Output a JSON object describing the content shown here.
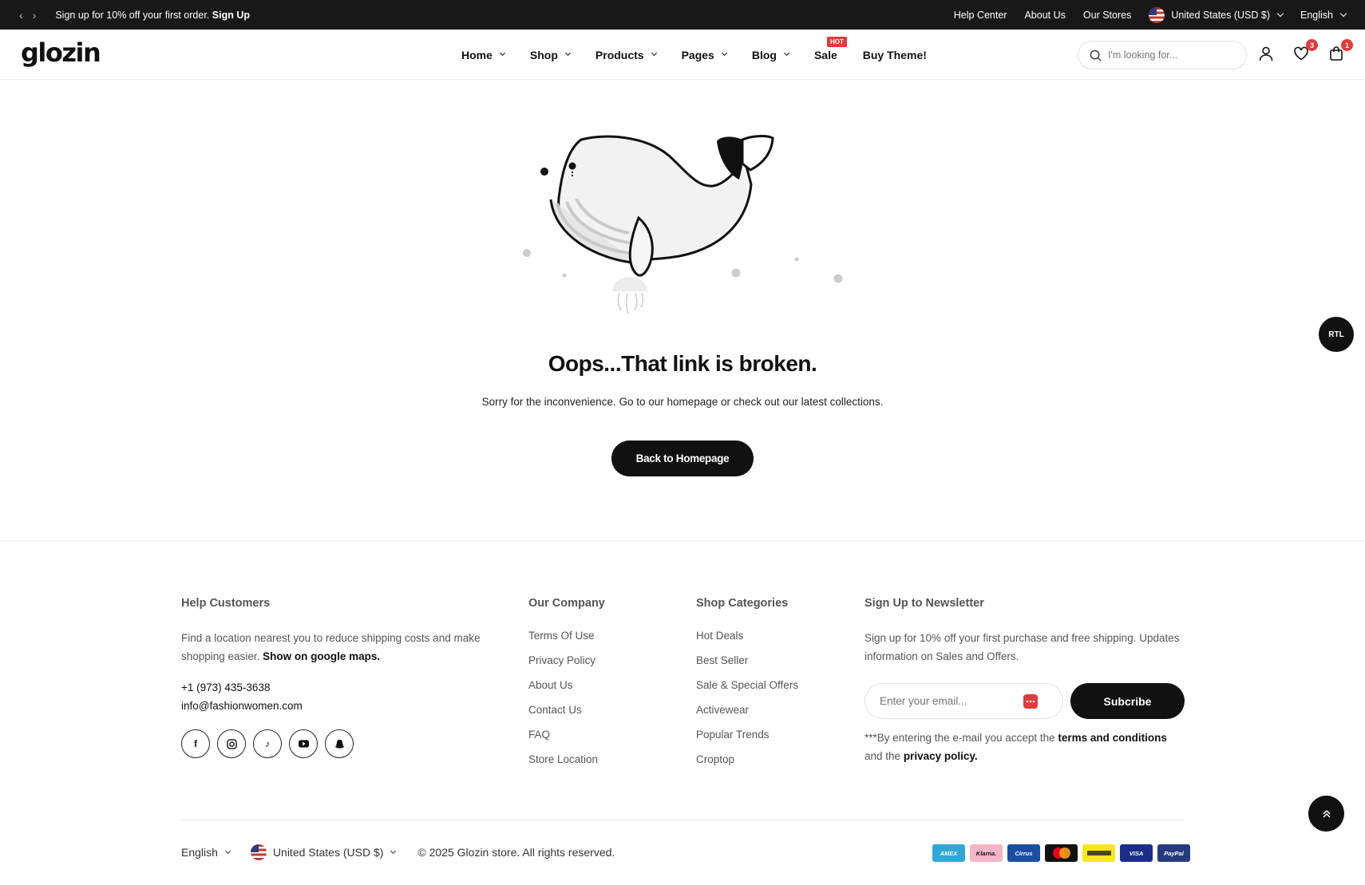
{
  "topbar": {
    "promo_text": "Sign up for 10% off your first order.",
    "promo_link": "Sign Up",
    "links": [
      "Help Center",
      "About Us",
      "Our Stores"
    ],
    "currency": "United States (USD $)",
    "language": "English"
  },
  "header": {
    "logo": "glozin",
    "nav": [
      "Home",
      "Shop",
      "Products",
      "Pages",
      "Blog",
      "Sale",
      "Buy Theme!"
    ],
    "hot_badge": "HOT",
    "search_placeholder": "I'm looking for...",
    "wishlist_count": "3",
    "cart_count": "1"
  },
  "error": {
    "title": "Oops...That link is broken.",
    "message": "Sorry for the inconvenience. Go to our homepage or check out our latest collections.",
    "button": "Back to Homepage"
  },
  "rtl_label": "RTL",
  "footer": {
    "help": {
      "heading": "Help Customers",
      "text": "Find a location nearest you to reduce shipping costs and make shopping easier.",
      "map_link": "Show on google maps.",
      "phone": "+1 (973) 435-3638",
      "email": "info@fashionwomen.com"
    },
    "company": {
      "heading": "Our Company",
      "links": [
        "Terms Of Use",
        "Privacy Policy",
        "About Us",
        "Contact Us",
        "FAQ",
        "Store Location"
      ]
    },
    "categories": {
      "heading": "Shop Categories",
      "links": [
        "Hot Deals",
        "Best Seller",
        "Sale & Special Offers",
        "Activewear",
        "Popular Trends",
        "Croptop"
      ]
    },
    "newsletter": {
      "heading": "Sign Up to Newsletter",
      "text": "Sign up for 10% off your first purchase and free shipping. Updates information on Sales and Offers.",
      "email_placeholder": "Enter your email...",
      "button": "Subcribe",
      "disclaimer_pre": "***By entering the e-mail you accept the",
      "terms": "terms and conditions",
      "disclaimer_mid": "and the",
      "privacy": "privacy policy."
    },
    "bottom": {
      "language": "English",
      "currency": "United States (USD $)",
      "copyright": "© 2025 Glozin store. All rights reserved."
    },
    "payments": [
      {
        "label": "AMEX",
        "color": "#2fa8d8"
      },
      {
        "label": "Klarna.",
        "color": "#f4b6c7"
      },
      {
        "label": "Cirrus",
        "color": "#1b4ea3"
      },
      {
        "label": "",
        "color": "#111111"
      },
      {
        "label": "",
        "color": "#f8e71c"
      },
      {
        "label": "VISA",
        "color": "#1a2d8a"
      },
      {
        "label": "PayPal",
        "color": "#253b80"
      }
    ]
  }
}
